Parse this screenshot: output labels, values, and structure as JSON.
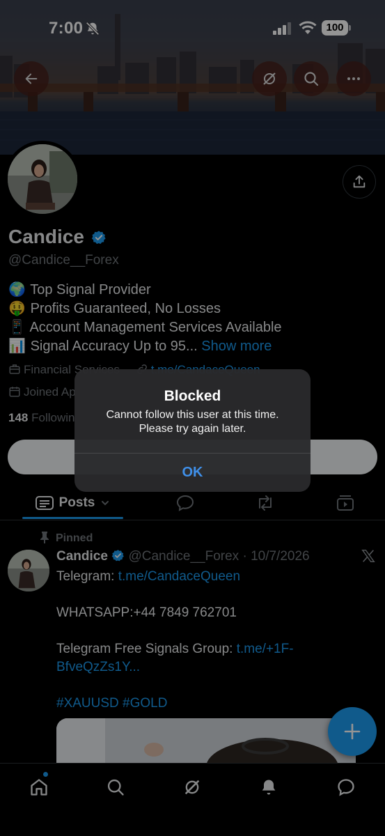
{
  "status_bar": {
    "time": "7:00",
    "battery": "100"
  },
  "profile": {
    "display_name": "Candice",
    "handle": "@Candice__Forex",
    "bio": [
      {
        "emoji": "🌍",
        "text": "Top Signal Provider"
      },
      {
        "emoji": "🤑",
        "text": "Profits Guaranteed, No Losses"
      },
      {
        "emoji": "📱",
        "text": "Account Management Services Available"
      },
      {
        "emoji": "📊",
        "text": "Signal Accuracy Up to 95..."
      }
    ],
    "show_more": "Show more",
    "category": "Financial Services",
    "link": "t.me/CandaceQueen",
    "joined": "Joined Ap",
    "following_count": "148",
    "following_label": "Followin"
  },
  "tabs": {
    "posts": "Posts"
  },
  "post": {
    "pinned_label": "Pinned",
    "name": "Candice",
    "handle_date": "@Candice__Forex · 10/7/2026",
    "telegram_label": "Telegram: ",
    "telegram_link": "t.me/CandaceQueen",
    "whatsapp": "WHATSAPP:+44 7849 762701",
    "group_label": "Telegram Free Signals Group: ",
    "group_link_1": "t.me/+1F-",
    "group_link_2": "BfveQzZs1Y...",
    "hashtags": "#XAUUSD #GOLD"
  },
  "alert": {
    "title": "Blocked",
    "message_1": "Cannot follow this user at this time.",
    "message_2": "Please try again later.",
    "ok": "OK"
  },
  "colors": {
    "accent": "#1d9bf0",
    "alert_button": "#3f8fe8",
    "muted": "#71767b"
  }
}
